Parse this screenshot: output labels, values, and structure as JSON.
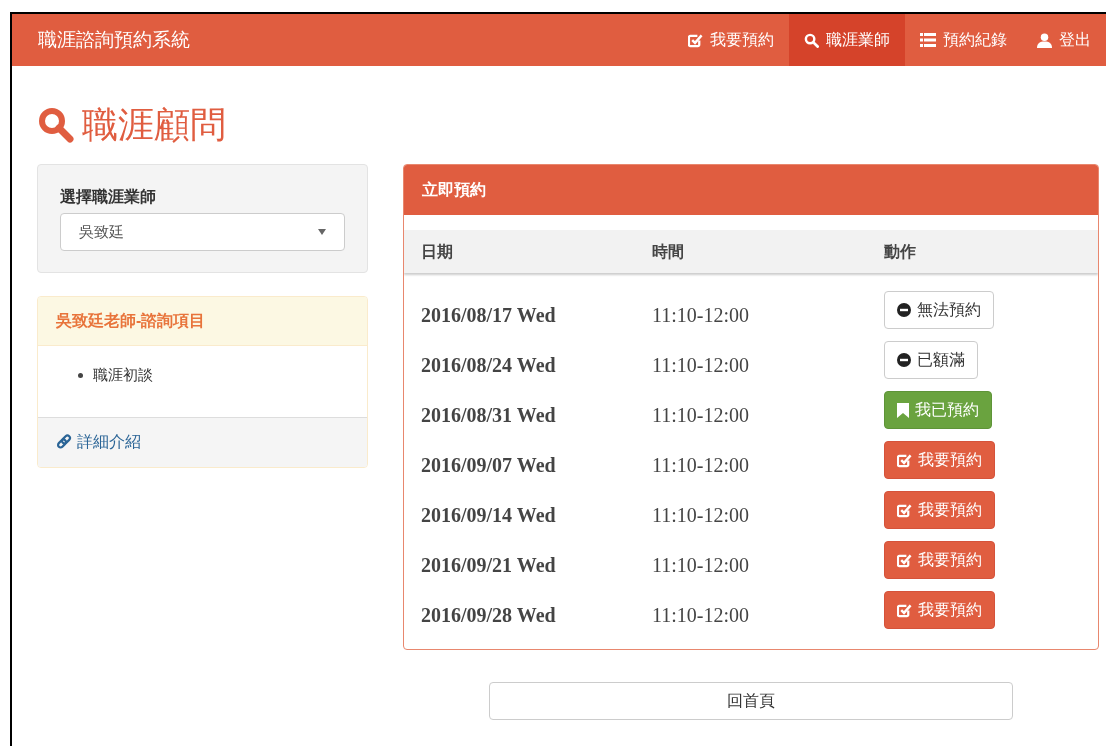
{
  "navbar": {
    "brand": "職涯諮詢預約系統",
    "items": [
      {
        "label": "我要預約",
        "selected": false
      },
      {
        "label": "職涯業師",
        "selected": true
      },
      {
        "label": "預約紀錄",
        "selected": false
      },
      {
        "label": "登出",
        "selected": false
      }
    ]
  },
  "page_title": "職涯顧問",
  "selector": {
    "label": "選擇職涯業師",
    "value": "吳致廷"
  },
  "consult_panel": {
    "title": "吳致廷老師-諮詢項目",
    "items": [
      "職涯初談"
    ],
    "link": "詳細介紹"
  },
  "booking_panel": {
    "title": "立即預約",
    "columns": [
      "日期",
      "時間",
      "動作"
    ],
    "rows": [
      {
        "date": "2016/08/17 Wed",
        "time": "11:10-12:00",
        "action": {
          "kind": "unavailable",
          "label": "無法預約"
        }
      },
      {
        "date": "2016/08/24 Wed",
        "time": "11:10-12:00",
        "action": {
          "kind": "full",
          "label": "已額滿"
        }
      },
      {
        "date": "2016/08/31 Wed",
        "time": "11:10-12:00",
        "action": {
          "kind": "booked",
          "label": "我已預約"
        }
      },
      {
        "date": "2016/09/07 Wed",
        "time": "11:10-12:00",
        "action": {
          "kind": "book",
          "label": "我要預約"
        }
      },
      {
        "date": "2016/09/14 Wed",
        "time": "11:10-12:00",
        "action": {
          "kind": "book",
          "label": "我要預約"
        }
      },
      {
        "date": "2016/09/21 Wed",
        "time": "11:10-12:00",
        "action": {
          "kind": "book",
          "label": "我要預約"
        }
      },
      {
        "date": "2016/09/28 Wed",
        "time": "11:10-12:00",
        "action": {
          "kind": "book",
          "label": "我要預約"
        }
      }
    ]
  },
  "home_button": "回首頁"
}
